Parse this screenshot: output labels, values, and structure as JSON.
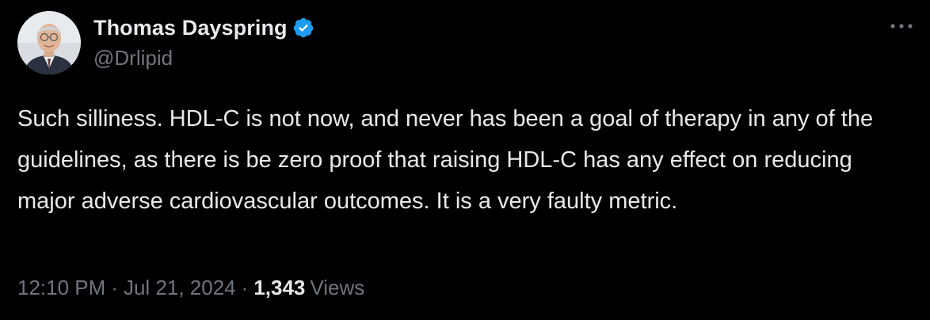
{
  "author": {
    "display_name": "Thomas Dayspring",
    "handle": "@Drlipid",
    "verified": true,
    "verified_color": "#1d9bf0",
    "avatar_icon": "profile-photo"
  },
  "menu": {
    "more_icon": "ellipsis-icon"
  },
  "tweet": {
    "text": "Such silliness. HDL-C is not now, and never has been a goal of therapy in any of the guidelines, as there is be zero proof that raising HDL-C has any effect on reducing major adverse cardiovascular outcomes. It is a very faulty metric."
  },
  "meta": {
    "time": "12:10 PM",
    "separator": "·",
    "date": "Jul 21, 2024",
    "views_count": "1,343",
    "views_label": "Views"
  },
  "colors": {
    "background": "#000000",
    "primary_text": "#e7e9ea",
    "secondary_text": "#71767b",
    "accent": "#1d9bf0"
  }
}
